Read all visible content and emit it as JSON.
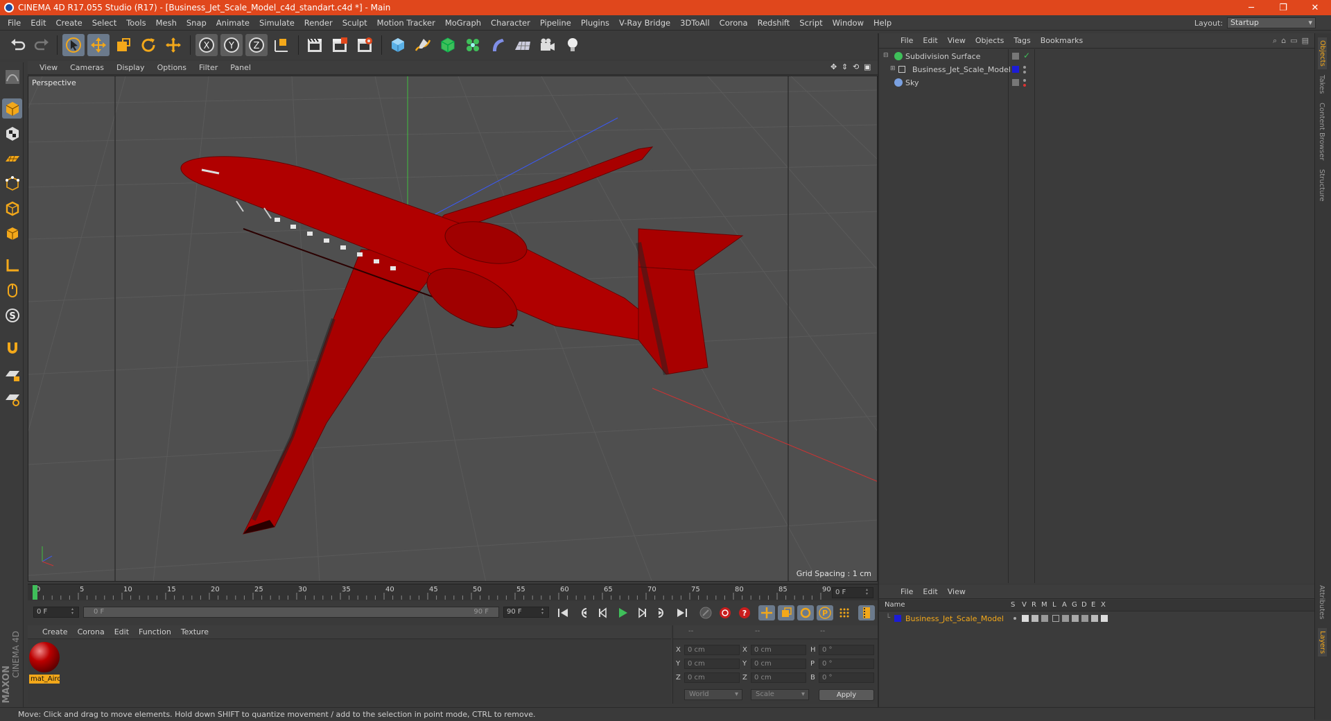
{
  "window": {
    "title": "CINEMA 4D R17.055 Studio (R17) - [Business_Jet_Scale_Model_c4d_standart.c4d *] - Main",
    "minimize": "─",
    "restore": "❐",
    "close": "✕"
  },
  "menubar": {
    "items": [
      "File",
      "Edit",
      "Create",
      "Select",
      "Tools",
      "Mesh",
      "Snap",
      "Animate",
      "Simulate",
      "Render",
      "Sculpt",
      "Motion Tracker",
      "MoGraph",
      "Character",
      "Pipeline",
      "Plugins",
      "V-Ray Bridge",
      "3DToAll",
      "Corona",
      "Redshift",
      "Script",
      "Window",
      "Help"
    ],
    "layout_label": "Layout:",
    "layout_value": "Startup"
  },
  "viewport": {
    "menu": [
      "View",
      "Cameras",
      "Display",
      "Options",
      "Filter",
      "Panel"
    ],
    "label": "Perspective",
    "grid_spacing": "Grid Spacing : 1 cm"
  },
  "timeline": {
    "ticks": [
      "0",
      "5",
      "10",
      "15",
      "20",
      "25",
      "30",
      "35",
      "40",
      "45",
      "50",
      "55",
      "60",
      "65",
      "70",
      "75",
      "80",
      "85",
      "90"
    ],
    "current_frame": "0 F",
    "start_field": "0 F",
    "slider_start": "0 F",
    "slider_end": "90 F",
    "end_field": "90 F"
  },
  "material_manager": {
    "menu": [
      "Create",
      "Corona",
      "Edit",
      "Function",
      "Texture"
    ],
    "materials": [
      {
        "name": "mat_Aircraft"
      }
    ]
  },
  "coordinates": {
    "headers": [
      "--",
      "--",
      "--"
    ],
    "rows": [
      {
        "l1": "X",
        "v1": "0 cm",
        "l2": "X",
        "v2": "0 cm",
        "l3": "H",
        "v3": "0 °"
      },
      {
        "l1": "Y",
        "v1": "0 cm",
        "l2": "Y",
        "v2": "0 cm",
        "l3": "P",
        "v3": "0 °"
      },
      {
        "l1": "Z",
        "v1": "0 cm",
        "l2": "Z",
        "v2": "0 cm",
        "l3": "B",
        "v3": "0 °"
      }
    ],
    "mode1": "World",
    "mode2": "Scale",
    "apply": "Apply"
  },
  "object_manager": {
    "menu": [
      "File",
      "Edit",
      "View",
      "Objects",
      "Tags",
      "Bookmarks"
    ],
    "objects": [
      {
        "name": "Subdivision Surface"
      },
      {
        "name": "Business_Jet_Scale_Model"
      },
      {
        "name": "Sky"
      }
    ]
  },
  "layer_manager": {
    "menu": [
      "File",
      "Edit",
      "View"
    ],
    "columns": [
      "Name",
      "S",
      "V",
      "R",
      "M",
      "L",
      "A",
      "G",
      "D",
      "E",
      "X"
    ],
    "layers": [
      {
        "name": "Business_Jet_Scale_Model"
      }
    ]
  },
  "side_tabs": [
    "Objects",
    "Takes",
    "Content Browser",
    "Structure",
    "Attributes",
    "Layers"
  ],
  "status": "Move: Click and drag to move elements. Hold down SHIFT to quantize movement / add to the selection in point mode, CTRL to remove.",
  "logo": {
    "brand": "MAXON",
    "product": "CINEMA 4D"
  },
  "colors": {
    "accent": "#e0471c",
    "highlight": "#f3a81a",
    "jet": "#b00000",
    "active_tool": "#6b7a8c"
  }
}
